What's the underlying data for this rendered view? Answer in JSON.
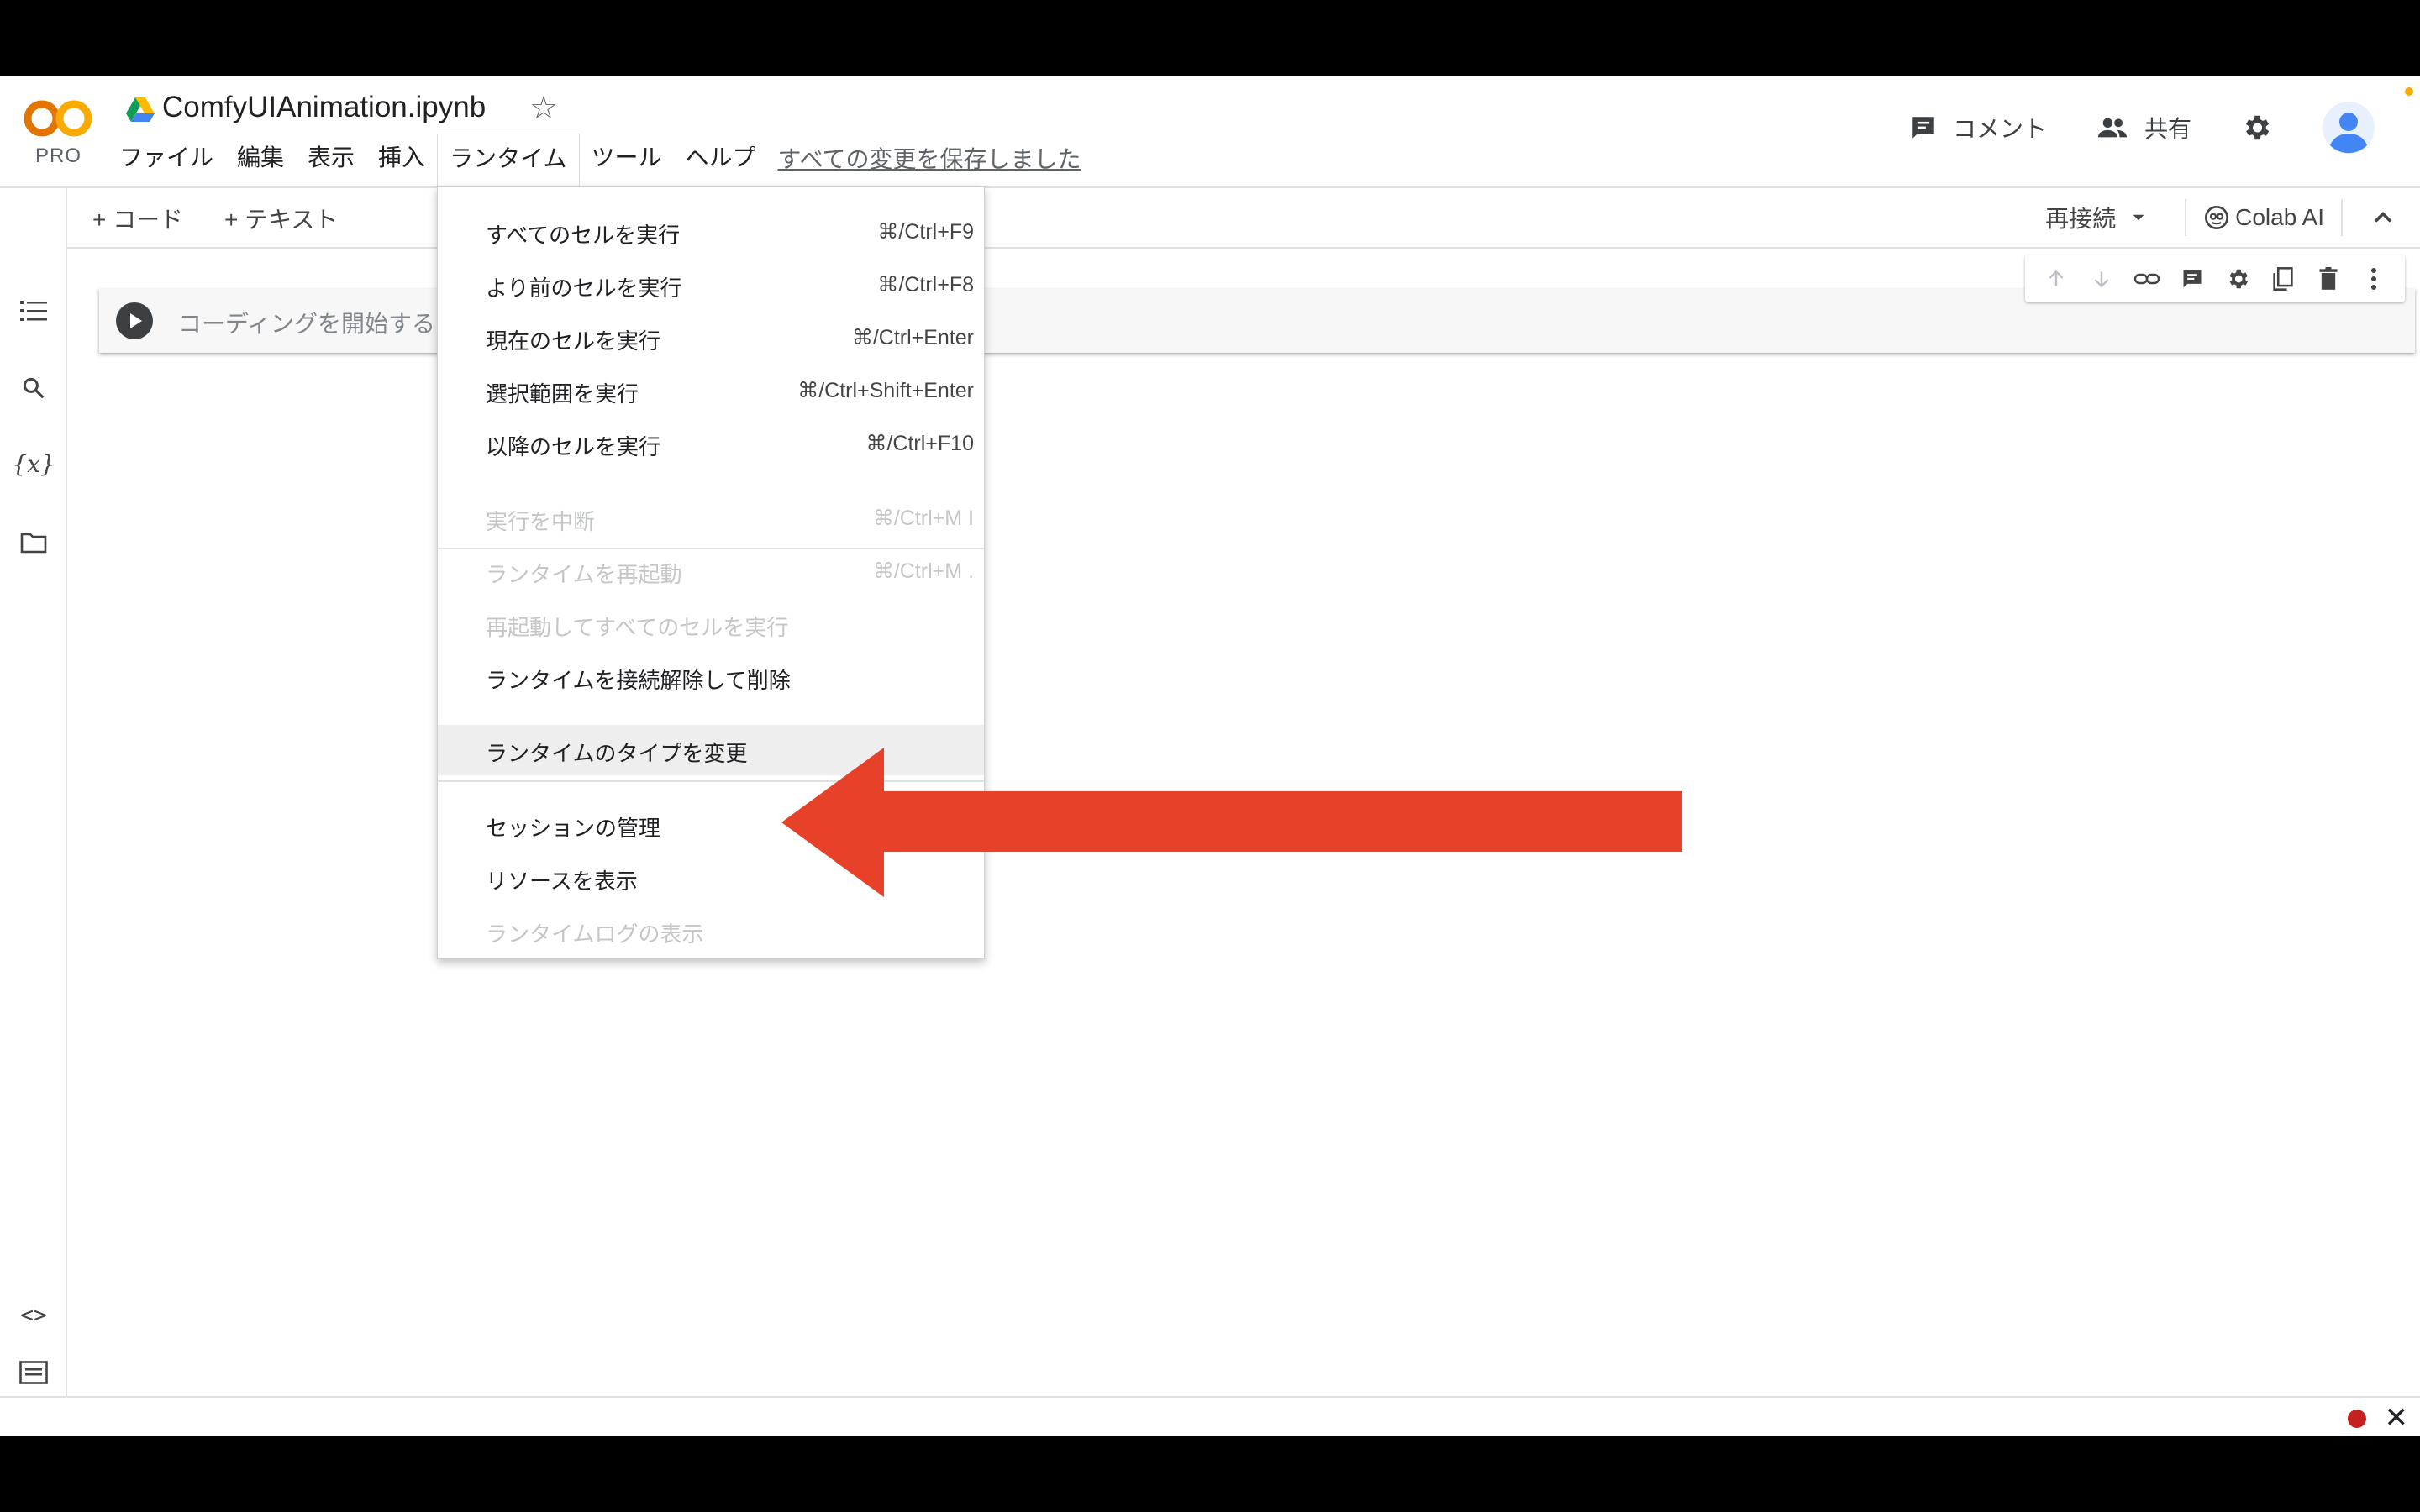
{
  "app": {
    "logo_text": "CO",
    "plan_badge": "PRO",
    "doc_title": "ComfyUIAnimation.ipynb"
  },
  "menubar": {
    "items": [
      "ファイル",
      "編集",
      "表示",
      "挿入",
      "ランタイム",
      "ツール",
      "ヘルプ"
    ],
    "active": "ランタイム",
    "saved_status": "すべての変更を保存しました"
  },
  "header": {
    "comment_label": "コメント",
    "share_label": "共有"
  },
  "toolbar": {
    "add_code_label": "+ コード",
    "add_text_label": "+ テキスト",
    "reconnect_label": "再接続",
    "colab_ai_label": "Colab AI"
  },
  "cell": {
    "placeholder": "コーディングを開始する"
  },
  "runtime_menu": {
    "items": [
      {
        "label": "すべてのセルを実行",
        "shortcut": "⌘/Ctrl+F9",
        "enabled": true
      },
      {
        "label": "より前のセルを実行",
        "shortcut": "⌘/Ctrl+F8",
        "enabled": true
      },
      {
        "label": "現在のセルを実行",
        "shortcut": "⌘/Ctrl+Enter",
        "enabled": true
      },
      {
        "label": "選択範囲を実行",
        "shortcut": "⌘/Ctrl+Shift+Enter",
        "enabled": true
      },
      {
        "label": "以降のセルを実行",
        "shortcut": "⌘/Ctrl+F10",
        "enabled": true
      },
      {
        "label": "実行を中断",
        "shortcut": "⌘/Ctrl+M I",
        "enabled": false
      },
      {
        "label": "ランタイムを再起動",
        "shortcut": "⌘/Ctrl+M .",
        "enabled": false
      },
      {
        "label": "再起動してすべてのセルを実行",
        "shortcut": "",
        "enabled": false
      },
      {
        "label": "ランタイムを接続解除して削除",
        "shortcut": "",
        "enabled": true
      },
      {
        "label": "ランタイムのタイプを変更",
        "shortcut": "",
        "enabled": true,
        "highlighted": true
      },
      {
        "label": "セッションの管理",
        "shortcut": "",
        "enabled": true
      },
      {
        "label": "リソースを表示",
        "shortcut": "",
        "enabled": true
      },
      {
        "label": "ランタイムログの表示",
        "shortcut": "",
        "enabled": false
      }
    ]
  },
  "colors": {
    "annotation_arrow": "#e8412a",
    "record_dot": "#c5221f",
    "logo_orange": "#f9ab00",
    "logo_dark_orange": "#e37400"
  }
}
